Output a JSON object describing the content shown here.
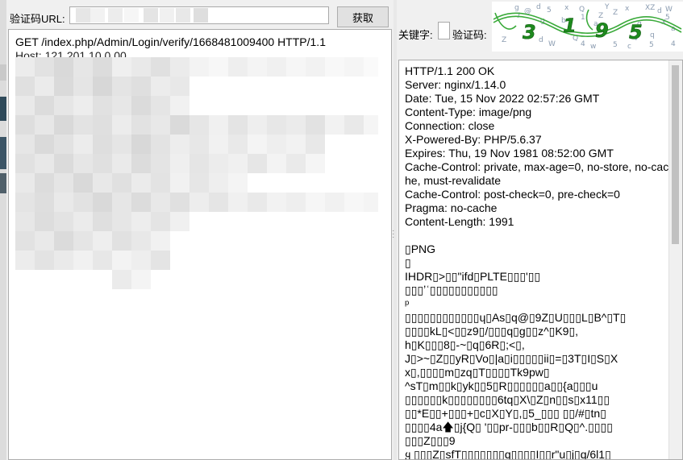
{
  "left_panel": {
    "url_label": "验证码URL:",
    "url_value": "",
    "fetch_button_label": "获取",
    "request_line": "GET /index.php/Admin/Login/verify/1668481009400 HTTP/1.1",
    "host_line": "Host: 121.201.10.0.00"
  },
  "right_panel": {
    "keyword_label": "关键字:",
    "captcha_label": "验证码:",
    "captcha_text": "3195",
    "response_text": "HTTP/1.1 200 OK\nServer: nginx/1.14.0\nDate: Tue, 15 Nov 2022 02:57:26 GMT\nContent-Type: image/png\nConnection: close\nX-Powered-By: PHP/5.6.37\nExpires: Thu, 19 Nov 1981 08:52:00 GMT\nCache-Control: private, max-age=0, no-store, no-cache, must-revalidate\nCache-Control: post-check=0, pre-check=0\nPragma: no-cache\nContent-Length: 1991\n\n▯PNG\n▯\nIHDR▯>▯▯\"ifd▯PLTE▯▯▯'▯▯\n▯▯▯ʼʿ▯▯▯▯▯▯▯▯▯▯▯\nᵖ\n▯▯▯▯▯▯▯▯▯▯▯▯ɥ▯As▯q@▯9Z▯U▯▯▯L▯B^▯T▯\n▯▯▯▯kL▯<▯▯z9▯/▯▯▯q▯g▯▯z^▯K9▯,\nh▯K▯▯▯8▯-~▯q▯6R▯;<▯,\nJ▯>~▯Z▯▯yR▯Vo▯|a▯i▯▯▯▯▯ii▯=▯3T▯I▯S▯X\nx▯,▯▯▯▯m▯zq▯T▯▯▯▯Tk9pw▯\n^sT▯m▯▯k▯yk▯▯5▯R▯▯▯▯▯▯a▯▯{a▯▯▯u\n▯▯▯▯▯▯k▯▯▯▯▯▯▯▯6tq▯X\\▯Z▯n▯▯s▯x11▯▯\n▯▯*E▯▯+▯▯▯+▯c▯X▯Y▯,▯5_▯▯▯ ▯▯/#▯tn▯\n▯▯▯▯4a🡅▯j{Q▯ '▯▯pr-▯▯▯b▯▯R▯Q▯^.▯▯▯▯\n▯▯▯Z▯▯▯9\nყ ▯▯▯Z▯sfT▯▯▯▯▯▯▯q▯▯▯▯I▯▯r\"u▯j▯q/6l1▯"
  }
}
